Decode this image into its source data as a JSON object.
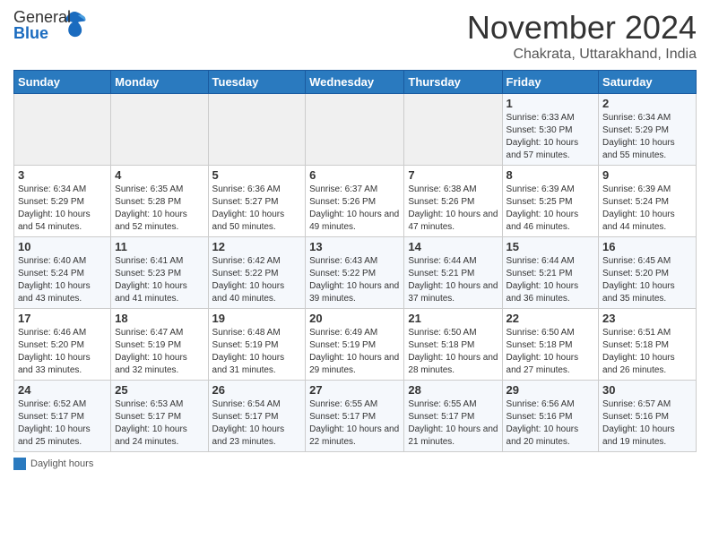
{
  "header": {
    "logo_general": "General",
    "logo_blue": "Blue",
    "title": "November 2024",
    "subtitle": "Chakrata, Uttarakhand, India"
  },
  "calendar": {
    "headers": [
      "Sunday",
      "Monday",
      "Tuesday",
      "Wednesday",
      "Thursday",
      "Friday",
      "Saturday"
    ],
    "rows": [
      [
        {
          "day": "",
          "info": ""
        },
        {
          "day": "",
          "info": ""
        },
        {
          "day": "",
          "info": ""
        },
        {
          "day": "",
          "info": ""
        },
        {
          "day": "",
          "info": ""
        },
        {
          "day": "1",
          "info": "Sunrise: 6:33 AM\nSunset: 5:30 PM\nDaylight: 10 hours and 57 minutes."
        },
        {
          "day": "2",
          "info": "Sunrise: 6:34 AM\nSunset: 5:29 PM\nDaylight: 10 hours and 55 minutes."
        }
      ],
      [
        {
          "day": "3",
          "info": "Sunrise: 6:34 AM\nSunset: 5:29 PM\nDaylight: 10 hours and 54 minutes."
        },
        {
          "day": "4",
          "info": "Sunrise: 6:35 AM\nSunset: 5:28 PM\nDaylight: 10 hours and 52 minutes."
        },
        {
          "day": "5",
          "info": "Sunrise: 6:36 AM\nSunset: 5:27 PM\nDaylight: 10 hours and 50 minutes."
        },
        {
          "day": "6",
          "info": "Sunrise: 6:37 AM\nSunset: 5:26 PM\nDaylight: 10 hours and 49 minutes."
        },
        {
          "day": "7",
          "info": "Sunrise: 6:38 AM\nSunset: 5:26 PM\nDaylight: 10 hours and 47 minutes."
        },
        {
          "day": "8",
          "info": "Sunrise: 6:39 AM\nSunset: 5:25 PM\nDaylight: 10 hours and 46 minutes."
        },
        {
          "day": "9",
          "info": "Sunrise: 6:39 AM\nSunset: 5:24 PM\nDaylight: 10 hours and 44 minutes."
        }
      ],
      [
        {
          "day": "10",
          "info": "Sunrise: 6:40 AM\nSunset: 5:24 PM\nDaylight: 10 hours and 43 minutes."
        },
        {
          "day": "11",
          "info": "Sunrise: 6:41 AM\nSunset: 5:23 PM\nDaylight: 10 hours and 41 minutes."
        },
        {
          "day": "12",
          "info": "Sunrise: 6:42 AM\nSunset: 5:22 PM\nDaylight: 10 hours and 40 minutes."
        },
        {
          "day": "13",
          "info": "Sunrise: 6:43 AM\nSunset: 5:22 PM\nDaylight: 10 hours and 39 minutes."
        },
        {
          "day": "14",
          "info": "Sunrise: 6:44 AM\nSunset: 5:21 PM\nDaylight: 10 hours and 37 minutes."
        },
        {
          "day": "15",
          "info": "Sunrise: 6:44 AM\nSunset: 5:21 PM\nDaylight: 10 hours and 36 minutes."
        },
        {
          "day": "16",
          "info": "Sunrise: 6:45 AM\nSunset: 5:20 PM\nDaylight: 10 hours and 35 minutes."
        }
      ],
      [
        {
          "day": "17",
          "info": "Sunrise: 6:46 AM\nSunset: 5:20 PM\nDaylight: 10 hours and 33 minutes."
        },
        {
          "day": "18",
          "info": "Sunrise: 6:47 AM\nSunset: 5:19 PM\nDaylight: 10 hours and 32 minutes."
        },
        {
          "day": "19",
          "info": "Sunrise: 6:48 AM\nSunset: 5:19 PM\nDaylight: 10 hours and 31 minutes."
        },
        {
          "day": "20",
          "info": "Sunrise: 6:49 AM\nSunset: 5:19 PM\nDaylight: 10 hours and 29 minutes."
        },
        {
          "day": "21",
          "info": "Sunrise: 6:50 AM\nSunset: 5:18 PM\nDaylight: 10 hours and 28 minutes."
        },
        {
          "day": "22",
          "info": "Sunrise: 6:50 AM\nSunset: 5:18 PM\nDaylight: 10 hours and 27 minutes."
        },
        {
          "day": "23",
          "info": "Sunrise: 6:51 AM\nSunset: 5:18 PM\nDaylight: 10 hours and 26 minutes."
        }
      ],
      [
        {
          "day": "24",
          "info": "Sunrise: 6:52 AM\nSunset: 5:17 PM\nDaylight: 10 hours and 25 minutes."
        },
        {
          "day": "25",
          "info": "Sunrise: 6:53 AM\nSunset: 5:17 PM\nDaylight: 10 hours and 24 minutes."
        },
        {
          "day": "26",
          "info": "Sunrise: 6:54 AM\nSunset: 5:17 PM\nDaylight: 10 hours and 23 minutes."
        },
        {
          "day": "27",
          "info": "Sunrise: 6:55 AM\nSunset: 5:17 PM\nDaylight: 10 hours and 22 minutes."
        },
        {
          "day": "28",
          "info": "Sunrise: 6:55 AM\nSunset: 5:17 PM\nDaylight: 10 hours and 21 minutes."
        },
        {
          "day": "29",
          "info": "Sunrise: 6:56 AM\nSunset: 5:16 PM\nDaylight: 10 hours and 20 minutes."
        },
        {
          "day": "30",
          "info": "Sunrise: 6:57 AM\nSunset: 5:16 PM\nDaylight: 10 hours and 19 minutes."
        }
      ]
    ]
  },
  "footer": {
    "legend_label": "Daylight hours"
  }
}
